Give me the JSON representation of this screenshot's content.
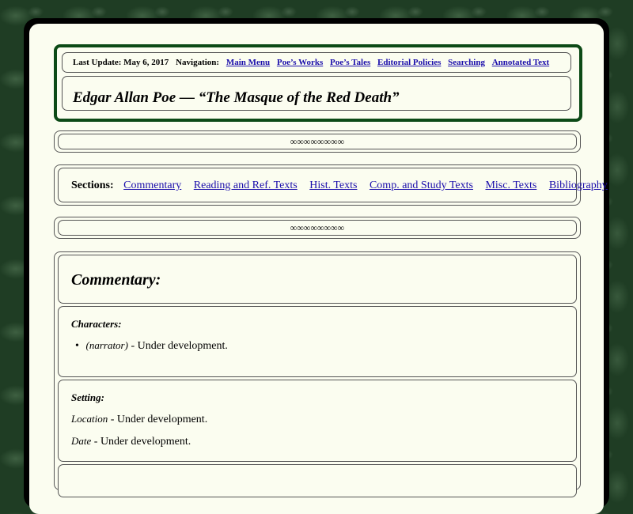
{
  "header": {
    "last_update": "Last Update: May 6, 2017",
    "nav_label": "Navigation:",
    "nav_links": [
      "Main Menu",
      "Poe’s Works",
      "Poe’s Tales",
      "Editorial Policies",
      "Searching",
      "Annotated Text"
    ],
    "title": "Edgar Allan Poe — “The Masque of the Red Death”"
  },
  "ornament": "∞∞∞∞∞∞∞∞",
  "sections": {
    "label": "Sections:",
    "links": [
      "Commentary",
      "Reading and Ref. Texts",
      "Hist. Texts",
      "Comp. and Study Texts",
      "Misc. Texts",
      "Bibliography"
    ]
  },
  "commentary": {
    "heading": "Commentary:",
    "characters": {
      "label": "Characters:",
      "items": [
        {
          "name": "(narrator)",
          "text": "- Under development."
        }
      ]
    },
    "setting": {
      "label": "Setting:",
      "location_label": "Location",
      "location_text": "- Under development.",
      "date_label": "Date",
      "date_text": "- Under development."
    }
  },
  "colors": {
    "background": "#1f3d24",
    "paper": "#fbfdf0",
    "header_border": "#0c4a16",
    "link": "#1a0dab"
  }
}
